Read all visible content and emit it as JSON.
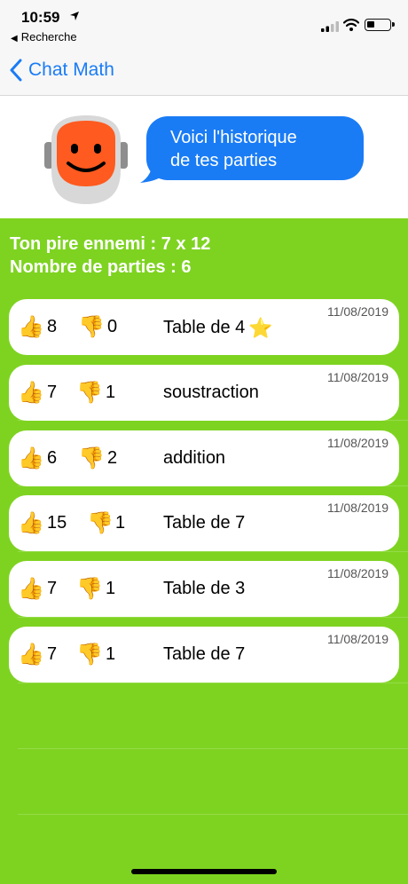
{
  "status_bar": {
    "time": "10:59",
    "back_app": "Recherche"
  },
  "nav": {
    "back_label": "Chat Math"
  },
  "header": {
    "bubble_line1": "Voici l'historique",
    "bubble_line2": "de tes parties"
  },
  "summary": {
    "worst_enemy": "Ton pire ennemi : 7 x 12",
    "games_count": "Nombre de parties : 6"
  },
  "games": [
    {
      "up": "8",
      "down": "0",
      "name": "Table de 4",
      "date": "11/08/2019",
      "star": true
    },
    {
      "up": "7",
      "down": "1",
      "name": "soustraction",
      "date": "11/08/2019",
      "star": false
    },
    {
      "up": "6",
      "down": "2",
      "name": "addition",
      "date": "11/08/2019",
      "star": false
    },
    {
      "up": "15",
      "down": "1",
      "name": "Table de 7",
      "date": "11/08/2019",
      "star": false
    },
    {
      "up": "7",
      "down": "1",
      "name": "Table de 3",
      "date": "11/08/2019",
      "star": false
    },
    {
      "up": "7",
      "down": "1",
      "name": "Table de 7",
      "date": "11/08/2019",
      "star": false
    }
  ],
  "icons": {
    "thumbs_up": "thumbs-up-icon",
    "thumbs_down": "thumbs-down-icon",
    "star": "star-icon"
  },
  "colors": {
    "background_green": "#7ED321",
    "accent_blue": "#1A7CF5",
    "robot_orange": "#FF5A1F"
  }
}
